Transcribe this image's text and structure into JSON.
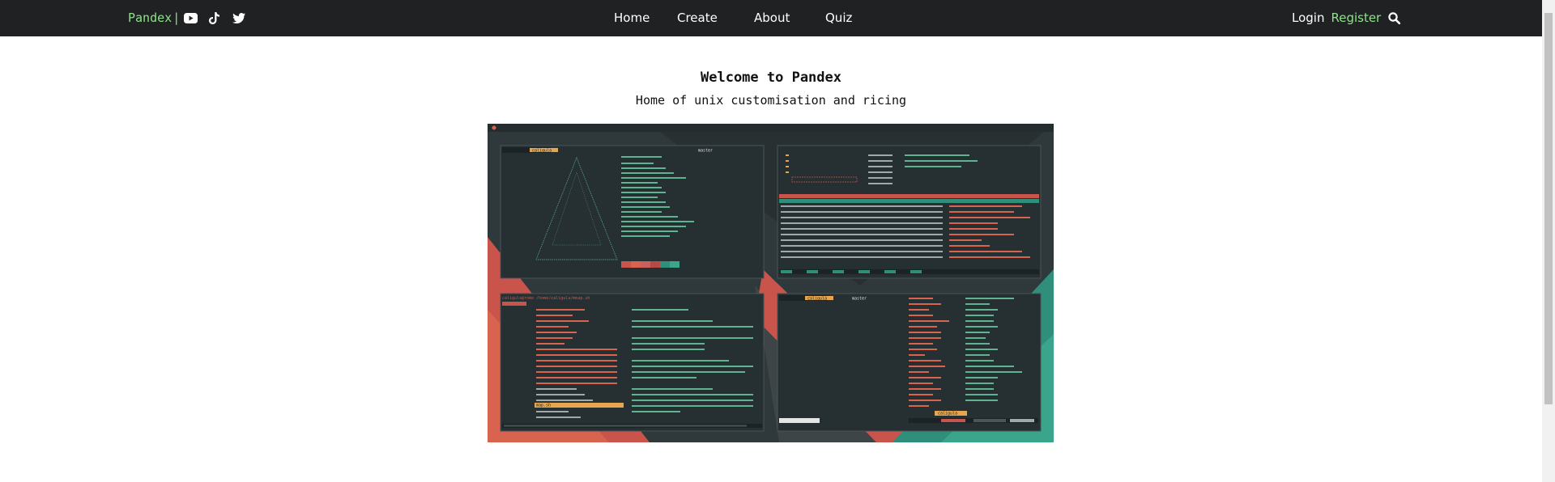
{
  "navbar": {
    "brand": "Pandex",
    "brand_separator": "|",
    "social": [
      {
        "icon": "youtube-icon"
      },
      {
        "icon": "tiktok-icon"
      },
      {
        "icon": "twitter-icon"
      }
    ],
    "links": [
      "Home",
      "Create",
      "About",
      "Quiz"
    ],
    "login": "Login",
    "register": "Register",
    "search_icon": "search-icon",
    "accent_color": "#8fe28a",
    "background_color": "#1f2123"
  },
  "hero": {
    "title": "Welcome to Pandex",
    "subtitle": "Home of unix customisation and ricing"
  },
  "screenshot": {
    "panes": {
      "top_left_user": "caligula@rome",
      "git_branch": "master",
      "file_path": "/home/caligula/mmap.sh",
      "selected_file": "map.sh"
    }
  }
}
